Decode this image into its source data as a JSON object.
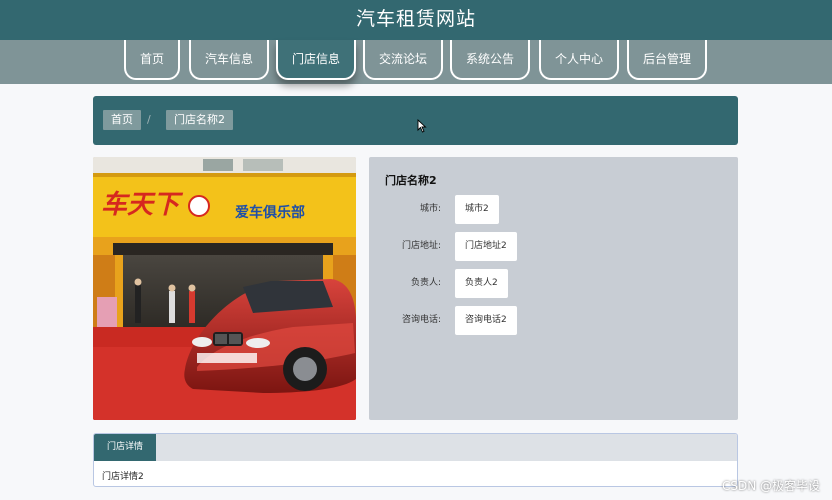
{
  "header": {
    "title": "汽车租赁网站"
  },
  "nav": {
    "items": [
      {
        "label": "首页"
      },
      {
        "label": "汽车信息"
      },
      {
        "label": "门店信息",
        "active": true
      },
      {
        "label": "交流论坛"
      },
      {
        "label": "系统公告"
      },
      {
        "label": "个人中心"
      },
      {
        "label": "后台管理"
      }
    ]
  },
  "breadcrumb": {
    "home": "首页",
    "separator": "/",
    "current": "门店名称2"
  },
  "store": {
    "image_alt": "门店图片",
    "sign_text_1": "车天下",
    "sign_text_2": "爱车俱乐部",
    "name": "门店名称2",
    "fields": [
      {
        "label": "城市:",
        "value": "城市2"
      },
      {
        "label": "门店地址:",
        "value": "门店地址2"
      },
      {
        "label": "负责人:",
        "value": "负责人2"
      },
      {
        "label": "咨询电话:",
        "value": "咨询电话2"
      }
    ]
  },
  "detail": {
    "tab_label": "门店详情",
    "content": "门店详情2"
  },
  "watermark": "CSDN @极客毕设",
  "colors": {
    "primary": "#336870",
    "nav_bg": "#7f9497",
    "panel_bg": "#c8cdd4"
  }
}
